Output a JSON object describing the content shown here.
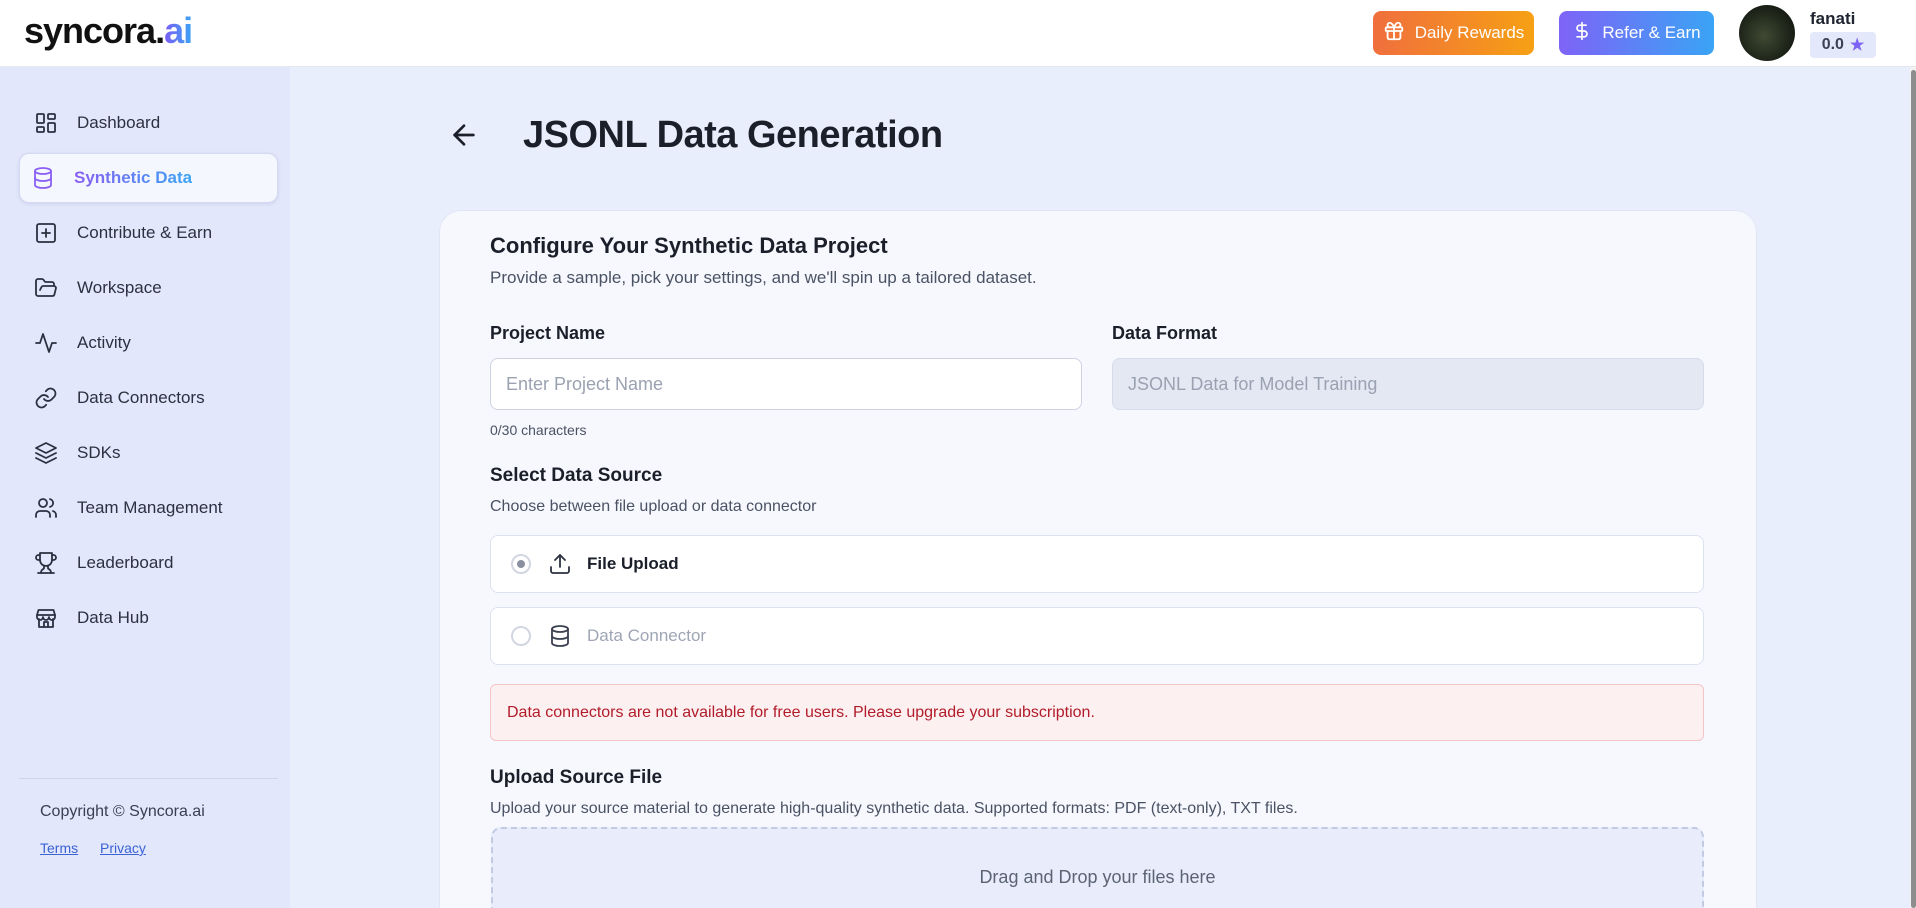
{
  "header": {
    "logo_main": "syncora.",
    "logo_accent": "ai",
    "daily_rewards_label": "Daily Rewards",
    "refer_earn_label": "Refer & Earn",
    "username": "fanati",
    "score": "0.0"
  },
  "sidebar": {
    "items": [
      {
        "label": "Dashboard",
        "icon": "dashboard-icon"
      },
      {
        "label": "Synthetic Data",
        "icon": "database-icon"
      },
      {
        "label": "Contribute & Earn",
        "icon": "plus-square-icon"
      },
      {
        "label": "Workspace",
        "icon": "folder-open-icon"
      },
      {
        "label": "Activity",
        "icon": "activity-icon"
      },
      {
        "label": "Data Connectors",
        "icon": "link-icon"
      },
      {
        "label": "SDKs",
        "icon": "layers-icon"
      },
      {
        "label": "Team Management",
        "icon": "users-icon"
      },
      {
        "label": "Leaderboard",
        "icon": "trophy-icon"
      },
      {
        "label": "Data Hub",
        "icon": "store-icon"
      }
    ],
    "active_index": 1,
    "copyright": "Copyright © Syncora.ai",
    "terms_label": "Terms",
    "privacy_label": "Privacy"
  },
  "main": {
    "title": "JSONL Data Generation",
    "card": {
      "title": "Configure Your Synthetic Data Project",
      "subtitle": "Provide a sample, pick your settings, and we'll spin up a tailored dataset.",
      "project_name_label": "Project Name",
      "project_name_placeholder": "Enter Project Name",
      "project_name_value": "",
      "char_count": "0/30 characters",
      "data_format_label": "Data Format",
      "data_format_placeholder": "JSONL Data for Model Training",
      "source_title": "Select Data Source",
      "source_subtitle": "Choose between file upload or data connector",
      "options": [
        {
          "label": "File Upload",
          "icon": "upload-icon",
          "selected": true
        },
        {
          "label": "Data Connector",
          "icon": "database-icon",
          "selected": false
        }
      ],
      "alert": "Data connectors are not available for free users. Please upgrade your subscription.",
      "upload_title": "Upload Source File",
      "upload_subtitle": "Upload your source material to generate high-quality synthetic data. Supported formats: PDF (text-only), TXT files.",
      "dropzone_text": "Drag and Drop your files here"
    }
  },
  "colors": {
    "accent_purple": "#7b5cf5",
    "accent_blue": "#3ba4f6",
    "daily_rewards_orange": "#f06f3d",
    "alert_red": "#b21c2a"
  }
}
